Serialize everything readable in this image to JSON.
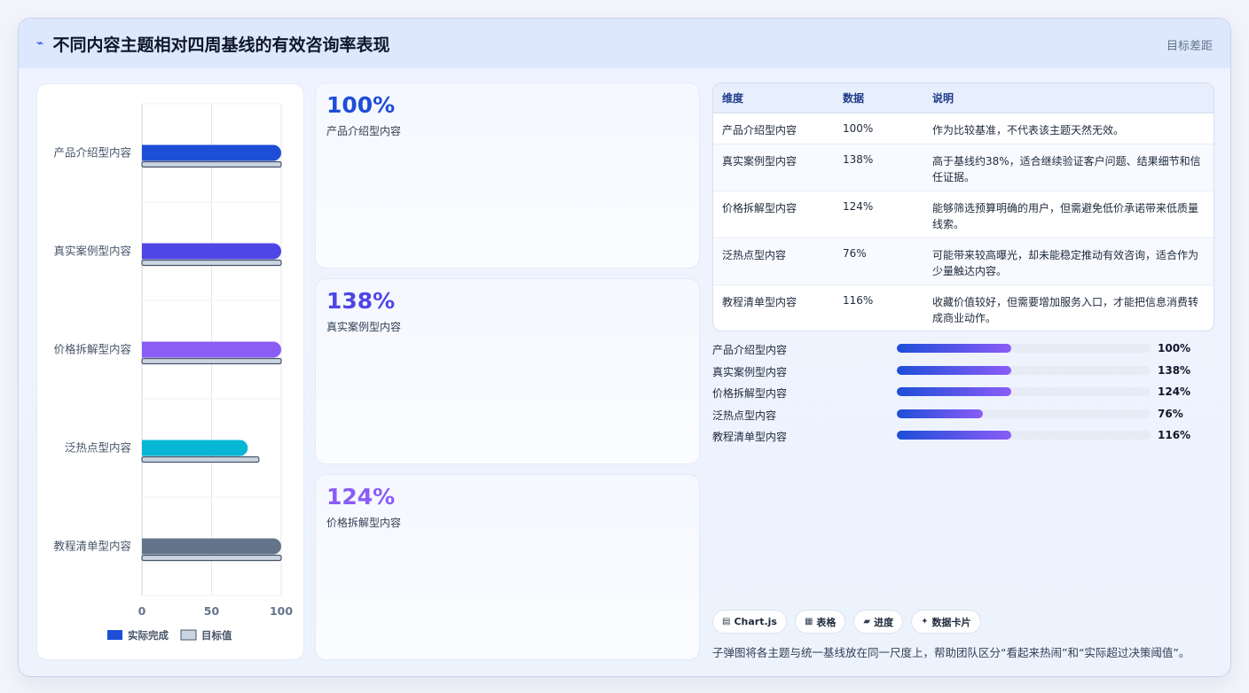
{
  "header": {
    "title": "不同内容主题相对四周基线的有效咨询率表现",
    "title_icon": "pulse-icon",
    "tag": "目标差距"
  },
  "chart_data": {
    "type": "bar",
    "orientation": "horizontal",
    "categories": [
      "产品介绍型内容",
      "真实案例型内容",
      "价格拆解型内容",
      "泛热点型内容",
      "教程清单型内容"
    ],
    "series": [
      {
        "name": "实际完成",
        "values": [
          100,
          138,
          124,
          76,
          116
        ],
        "colors": [
          "#1d4ed8",
          "#4f46e5",
          "#8b5cf6",
          "#06b6d4",
          "#64748b"
        ]
      },
      {
        "name": "目标值",
        "values": [
          100,
          100,
          100,
          84,
          100
        ],
        "color": "#cbd5e1"
      }
    ],
    "xlim": [
      0,
      100
    ],
    "xticks": [
      "0",
      "50",
      "100"
    ],
    "grid": true,
    "legend": "bottom"
  },
  "kpis": [
    {
      "value": "100%",
      "label": "产品介绍型内容",
      "color": "#1d4ed8"
    },
    {
      "value": "138%",
      "label": "真实案例型内容",
      "color": "#4f46e5"
    },
    {
      "value": "124%",
      "label": "价格拆解型内容",
      "color": "#8b5cf6"
    }
  ],
  "table": {
    "headers": [
      "维度",
      "数据",
      "说明"
    ],
    "rows": [
      [
        "产品介绍型内容",
        "100%",
        "作为比较基准，不代表该主题天然无效。"
      ],
      [
        "真实案例型内容",
        "138%",
        "高于基线约38%，适合继续验证客户问题、结果细节和信任证据。"
      ],
      [
        "价格拆解型内容",
        "124%",
        "能够筛选预算明确的用户，但需避免低价承诺带来低质量线索。"
      ],
      [
        "泛热点型内容",
        "76%",
        "可能带来较高曝光，却未能稳定推动有效咨询，适合作为少量触达内容。"
      ],
      [
        "教程清单型内容",
        "116%",
        "收藏价值较好，但需要增加服务入口，才能把信息消费转成商业动作。"
      ]
    ]
  },
  "progress": [
    {
      "label": "产品介绍型内容",
      "value": "100%",
      "fill": 0.45
    },
    {
      "label": "真实案例型内容",
      "value": "138%",
      "fill": 0.45
    },
    {
      "label": "价格拆解型内容",
      "value": "124%",
      "fill": 0.45
    },
    {
      "label": "泛热点型内容",
      "value": "76%",
      "fill": 0.34
    },
    {
      "label": "教程清单型内容",
      "value": "116%",
      "fill": 0.45
    }
  ],
  "chips": [
    {
      "icon": "chart-icon",
      "label": "Chart.js"
    },
    {
      "icon": "table-icon",
      "label": "表格"
    },
    {
      "icon": "progress-icon",
      "label": "进度"
    },
    {
      "icon": "sparkle-icon",
      "label": "数据卡片"
    }
  ],
  "footnote": "子弹图将各主题与统一基线放在同一尺度上，帮助团队区分“看起来热闹”和“实际超过决策阈值”。"
}
